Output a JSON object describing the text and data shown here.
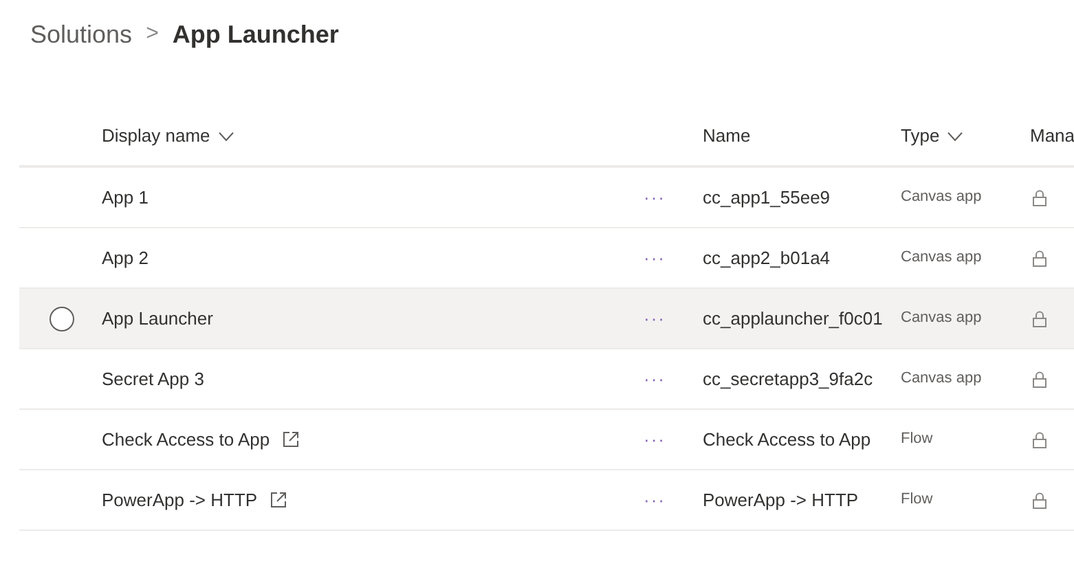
{
  "breadcrumb": {
    "parent": "Solutions",
    "separator": ">",
    "current": "App Launcher"
  },
  "table": {
    "columns": [
      {
        "label": "Display name",
        "sortable": true
      },
      {
        "label": "Name",
        "sortable": false
      },
      {
        "label": "Type",
        "sortable": true
      },
      {
        "label": "Mana",
        "sortable": false
      }
    ],
    "rows": [
      {
        "display_name": "App 1",
        "more": "···",
        "name": "cc_app1_55ee9",
        "type": "Canvas app",
        "external_link": false,
        "hovered": false
      },
      {
        "display_name": "App 2",
        "more": "···",
        "name": "cc_app2_b01a4",
        "type": "Canvas app",
        "external_link": false,
        "hovered": false
      },
      {
        "display_name": "App Launcher",
        "more": "···",
        "name": "cc_applauncher_f0c01",
        "type": "Canvas app",
        "external_link": false,
        "hovered": true
      },
      {
        "display_name": "Secret App 3",
        "more": "···",
        "name": "cc_secretapp3_9fa2c",
        "type": "Canvas app",
        "external_link": false,
        "hovered": false
      },
      {
        "display_name": "Check Access to App",
        "more": "···",
        "name": "Check Access to App",
        "type": "Flow",
        "external_link": true,
        "hovered": false
      },
      {
        "display_name": "PowerApp -> HTTP",
        "more": "···",
        "name": "PowerApp -> HTTP",
        "type": "Flow",
        "external_link": true,
        "hovered": false
      }
    ]
  }
}
